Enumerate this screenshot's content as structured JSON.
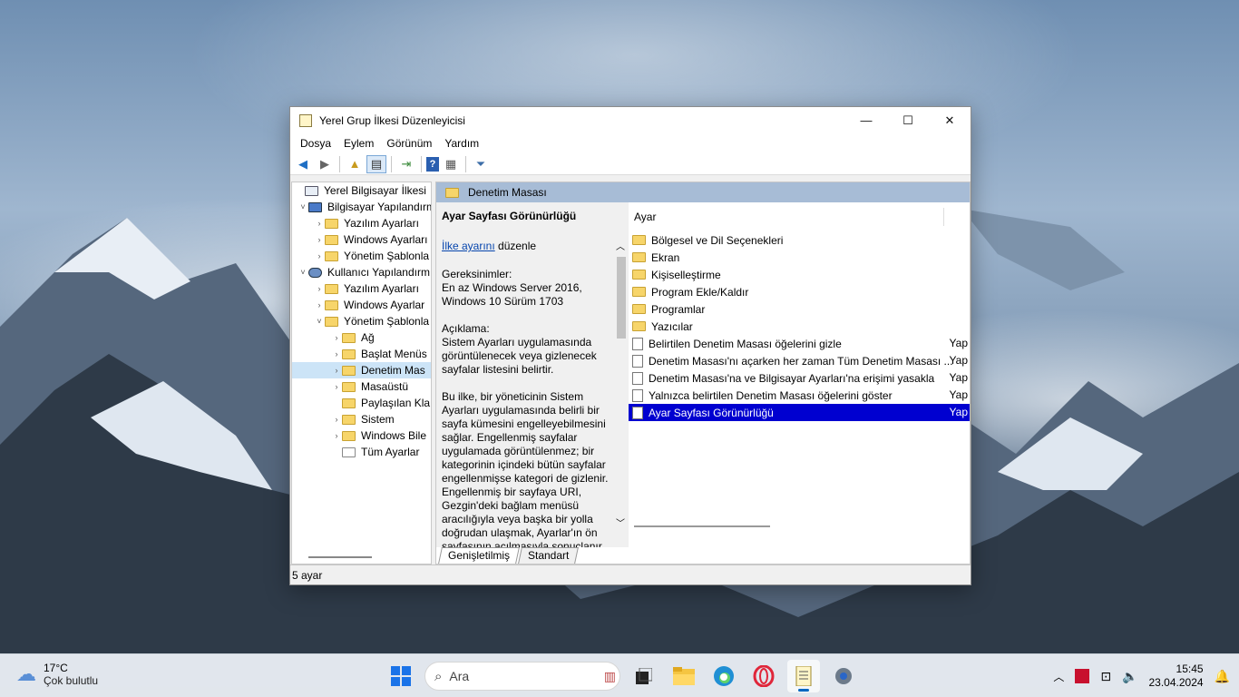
{
  "window": {
    "title": "Yerel Grup İlkesi Düzenleyicisi",
    "min": "—",
    "max": "☐",
    "close": "✕"
  },
  "menu": [
    "Dosya",
    "Eylem",
    "Görünüm",
    "Yardım"
  ],
  "tree": [
    {
      "label": "Yerel Bilgisayar İlkesi",
      "exp": ""
    },
    {
      "label": "Bilgisayar Yapılandırm",
      "exp": "˅"
    },
    {
      "label": "Yazılım Ayarları",
      "exp": "›"
    },
    {
      "label": "Windows Ayarları",
      "exp": "›"
    },
    {
      "label": "Yönetim Şablonla",
      "exp": "›"
    },
    {
      "label": "Kullanıcı Yapılandırm",
      "exp": "˅"
    },
    {
      "label": "Yazılım Ayarları",
      "exp": "›"
    },
    {
      "label": "Windows Ayarlar",
      "exp": "›"
    },
    {
      "label": "Yönetim Şablonla",
      "exp": "˅"
    },
    {
      "label": "Ağ",
      "exp": "›"
    },
    {
      "label": "Başlat Menüs",
      "exp": "›"
    },
    {
      "label": "Denetim Mas",
      "exp": "›"
    },
    {
      "label": "Masaüstü",
      "exp": "›"
    },
    {
      "label": "Paylaşılan Kla",
      "exp": ""
    },
    {
      "label": "Sistem",
      "exp": "›"
    },
    {
      "label": "Windows Bile",
      "exp": "›"
    },
    {
      "label": "Tüm Ayarlar",
      "exp": ""
    }
  ],
  "right_header": "Denetim Masası",
  "description": {
    "title": "Ayar Sayfası Görünürlüğü",
    "link": "İlke ayarını",
    "link_suffix": " düzenle",
    "req_label": "Gereksinimler:",
    "req_text": "En az Windows Server 2016, Windows 10 Sürüm 1703",
    "desc_label": "Açıklama:",
    "desc_text": "Sistem Ayarları uygulamasında görüntülenecek veya gizlenecek sayfalar listesini belirtir.",
    "desc_text2": "Bu ilke, bir yöneticinin Sistem Ayarları uygulamasında belirli bir sayfa kümesini engelleyebilmesini sağlar. Engellenmiş sayfalar uygulamada görüntülenmez; bir kategorinin içindeki bütün sayfalar engellenmişse kategori de gizlenir. Engellenmiş bir sayfaya URI, Gezgin'deki bağlam menüsü aracılığıyla veya başka bir yolla doğrudan ulaşmak, Ayarlar'ın ön sayfasının açılmasıyla sonuçlanır."
  },
  "list": {
    "column": "Ayar",
    "folders": [
      "Bölgesel ve Dil Seçenekleri",
      "Ekran",
      "Kişiselleştirme",
      "Program Ekle/Kaldır",
      "Programlar",
      "Yazıcılar"
    ],
    "policies": [
      {
        "label": "Belirtilen Denetim Masası öğelerini gizle",
        "state": "Yap"
      },
      {
        "label": "Denetim Masası'nı açarken her zaman Tüm Denetim Masası ...",
        "state": "Yap"
      },
      {
        "label": "Denetim Masası'na ve Bilgisayar Ayarları'na erişimi yasakla",
        "state": "Yap"
      },
      {
        "label": "Yalnızca belirtilen Denetim Masası öğelerini göster",
        "state": "Yap"
      },
      {
        "label": "Ayar Sayfası Görünürlüğü",
        "state": "Yap"
      }
    ]
  },
  "tabs": [
    "Genişletilmiş",
    "Standart"
  ],
  "status": "5 ayar",
  "taskbar": {
    "temp": "17°C",
    "weather": "Çok bulutlu",
    "search_placeholder": "Ara",
    "time": "15:45",
    "date": "23.04.2024"
  }
}
